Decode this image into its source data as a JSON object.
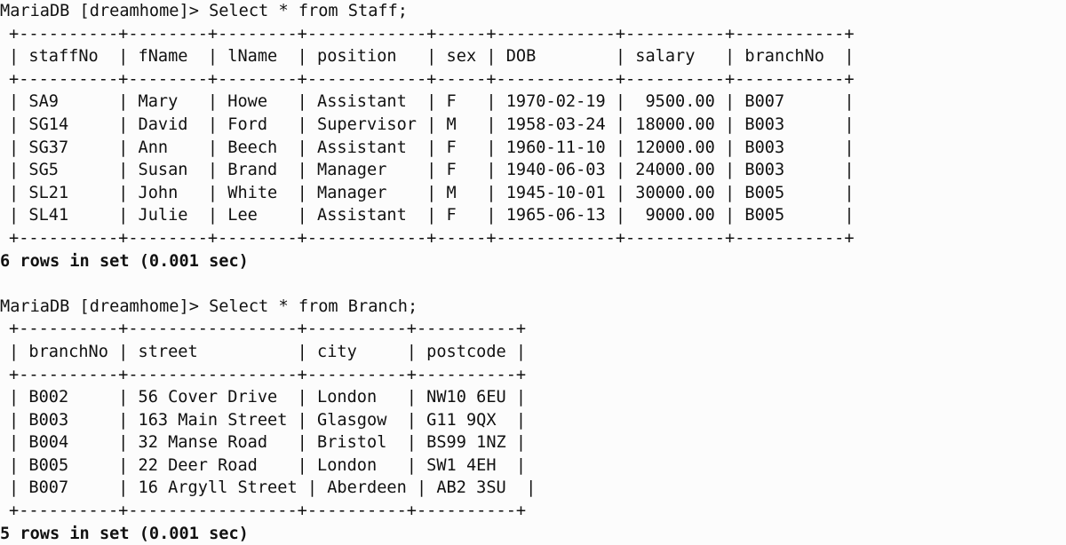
{
  "terminal": {
    "background_color": "#fcfcfc",
    "text_color": "#111111",
    "prompt_label": "MariaDB [dreamhome]>",
    "database": "dreamhome"
  },
  "sessions": [
    {
      "id": "staff-query",
      "prompt": "MariaDB [dreamhome]>",
      "command": " Select * from Staff;",
      "full_prompt_line": "MariaDB [dreamhome]> Select * from Staff;",
      "table": {
        "name": "Staff",
        "columns": [
          {
            "name": "staffNo",
            "width": 10,
            "align": "left"
          },
          {
            "name": "fName",
            "width": 8,
            "align": "left"
          },
          {
            "name": "lName",
            "width": 8,
            "align": "left"
          },
          {
            "name": "position",
            "width": 12,
            "align": "left"
          },
          {
            "name": "sex",
            "width": 5,
            "align": "left"
          },
          {
            "name": "DOB",
            "width": 12,
            "align": "left"
          },
          {
            "name": "salary",
            "width": 10,
            "align": "right"
          },
          {
            "name": "branchNo",
            "width": 11,
            "align": "left"
          }
        ],
        "rows": [
          [
            "SA9",
            "Mary",
            "Howe",
            "Assistant",
            "F",
            "1970-02-19",
            "9500.00",
            "B007"
          ],
          [
            "SG14",
            "David",
            "Ford",
            "Supervisor",
            "M",
            "1958-03-24",
            "18000.00",
            "B003"
          ],
          [
            "SG37",
            "Ann",
            "Beech",
            "Assistant",
            "F",
            "1960-11-10",
            "12000.00",
            "B003"
          ],
          [
            "SG5",
            "Susan",
            "Brand",
            "Manager",
            "F",
            "1940-06-03",
            "24000.00",
            "B003"
          ],
          [
            "SL21",
            "John",
            "White",
            "Manager",
            "M",
            "1945-10-01",
            "30000.00",
            "B005"
          ],
          [
            "SL41",
            "Julie",
            "Lee",
            "Assistant",
            "F",
            "1965-06-13",
            "9000.00",
            "B005"
          ]
        ]
      },
      "status": "6 rows in set (0.001 sec)",
      "row_count": 6,
      "duration": "0.001 sec"
    },
    {
      "id": "branch-query",
      "prompt": "MariaDB [dreamhome]>",
      "command": " Select * from Branch;",
      "full_prompt_line": "MariaDB [dreamhome]> Select * from Branch;",
      "table": {
        "name": "Branch",
        "columns": [
          {
            "name": "branchNo",
            "width": 10,
            "align": "left"
          },
          {
            "name": "street",
            "width": 17,
            "align": "left"
          },
          {
            "name": "city",
            "width": 10,
            "align": "left"
          },
          {
            "name": "postcode",
            "width": 10,
            "align": "left"
          }
        ],
        "rows": [
          [
            "B002",
            "56 Cover Drive",
            "London",
            "NW10 6EU"
          ],
          [
            "B003",
            "163 Main Street",
            "Glasgow",
            "G11 9QX"
          ],
          [
            "B004",
            "32 Manse Road",
            "Bristol",
            "BS99 1NZ"
          ],
          [
            "B005",
            "22 Deer Road",
            "London",
            "SW1 4EH"
          ],
          [
            "B007",
            "16 Argyll Street",
            "Aberdeen",
            "AB2 3SU"
          ]
        ]
      },
      "status": "5 rows in set (0.001 sec)",
      "row_count": 5,
      "duration": "0.001 sec"
    }
  ]
}
